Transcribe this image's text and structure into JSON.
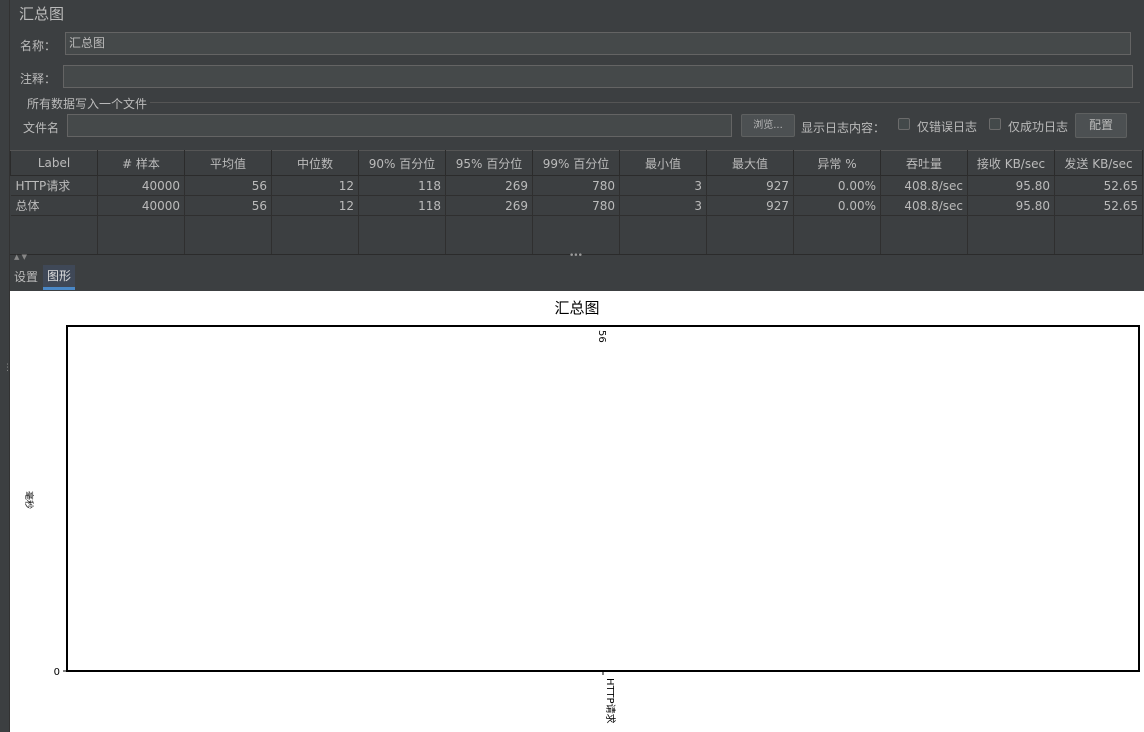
{
  "panel": {
    "title": "汇总图",
    "name_label": "名称：",
    "name_value": "汇总图",
    "comment_label": "注释：",
    "comment_value": "",
    "file_group_title": "所有数据写入一个文件",
    "filename_label": "文件名",
    "filename_value": "",
    "browse_button": "浏览...",
    "log_content_label": "显示日志内容：",
    "errors_only_label": "仅错误日志",
    "success_only_label": "仅成功日志",
    "config_button": "配置"
  },
  "table": {
    "headers": [
      "Label",
      "# 样本",
      "平均值",
      "中位数",
      "90% 百分位",
      "95% 百分位",
      "99% 百分位",
      "最小值",
      "最大值",
      "异常 %",
      "吞吐量",
      "接收 KB/sec",
      "发送 KB/sec"
    ],
    "rows": [
      [
        "HTTP请求",
        "40000",
        "56",
        "12",
        "118",
        "269",
        "780",
        "3",
        "927",
        "0.00%",
        "408.8/sec",
        "95.80",
        "52.65"
      ],
      [
        "总体",
        "40000",
        "56",
        "12",
        "118",
        "269",
        "780",
        "3",
        "927",
        "0.00%",
        "408.8/sec",
        "95.80",
        "52.65"
      ]
    ]
  },
  "tabs": [
    {
      "label": "设置",
      "active": false
    },
    {
      "label": "图形",
      "active": true
    }
  ],
  "chart_data": {
    "type": "bar",
    "title": "汇总图",
    "ylabel": "毫秒",
    "xlabel": "",
    "categories": [
      "HTTP请求"
    ],
    "series": [
      {
        "values": [
          56
        ]
      }
    ],
    "data_labels": [
      "56"
    ],
    "y_ticks": [
      "0"
    ],
    "ylim": [
      0,
      56
    ],
    "grid": false,
    "legend": "none"
  }
}
